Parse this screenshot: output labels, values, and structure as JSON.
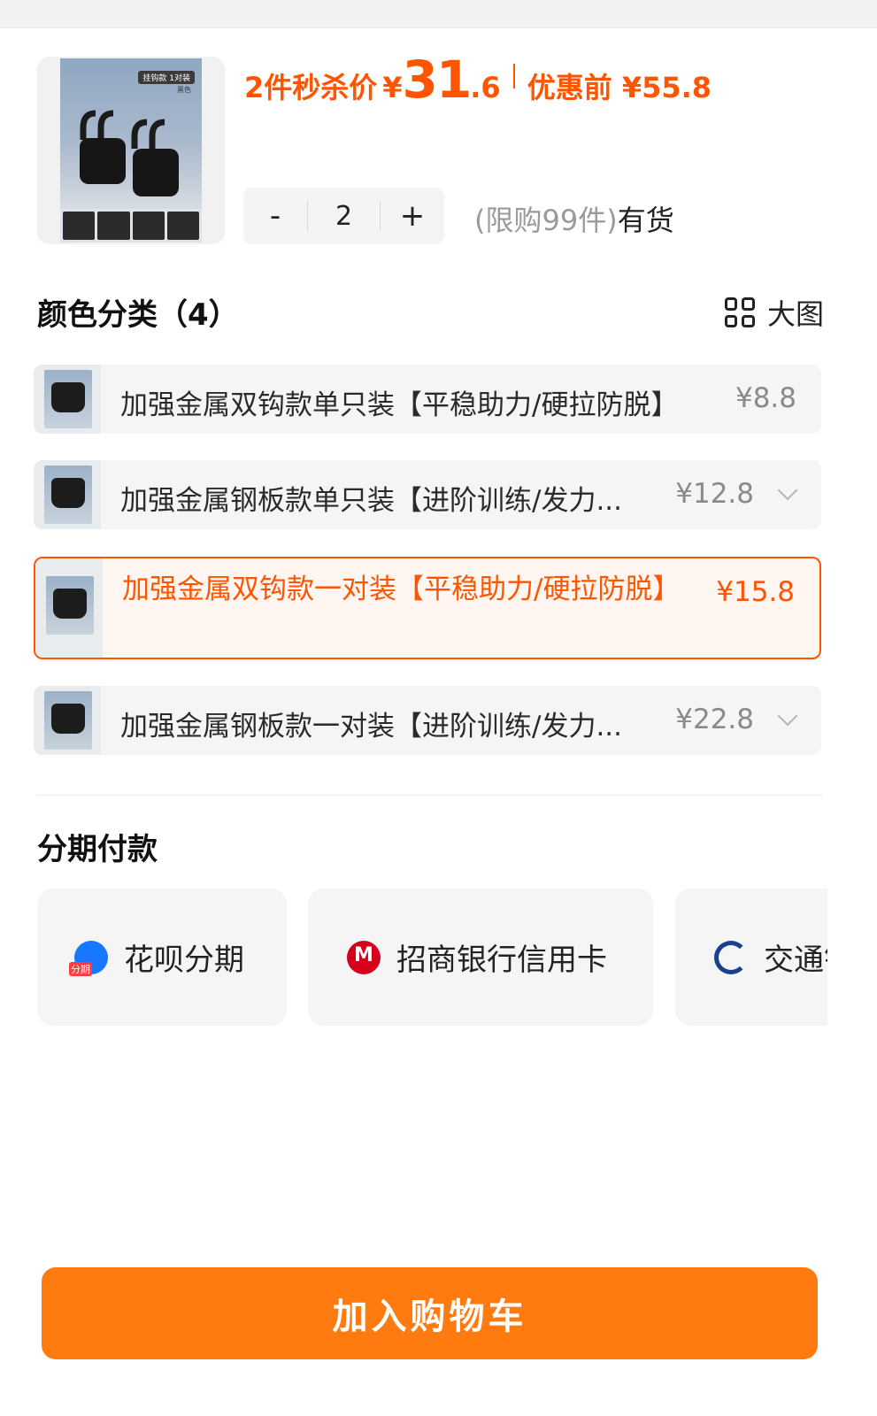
{
  "product": {
    "thumb_tag": "挂钩款 1对装",
    "thumb_sub": "黑色",
    "price_prefix": "2件秒杀价",
    "price_yen": "¥",
    "price_int": "31",
    "price_dec": ".6",
    "price_before": "优惠前 ¥55.8",
    "quantity": "2",
    "minus_label": "-",
    "plus_label": "+",
    "stock_limit": "(限购99件)",
    "stock_status": "有货"
  },
  "color_section": {
    "title": "颜色分类（4）",
    "big_view_label": "大图",
    "options": [
      {
        "label": "加强金属双钩款单只装【平稳助力/硬拉防脱】",
        "price": "¥8.8",
        "selected": false
      },
      {
        "label": "加强金属钢板款单只装【进阶训练/发力...",
        "price": "¥12.8",
        "selected": false
      },
      {
        "label": "加强金属双钩款一对装【平稳助力/硬拉防脱】",
        "price": "¥15.8",
        "selected": true
      },
      {
        "label": "加强金属钢板款一对装【进阶训练/发力...",
        "price": "¥22.8",
        "selected": false
      }
    ]
  },
  "installment": {
    "title": "分期付款",
    "options": [
      {
        "label": "花呗分期",
        "icon": "huabei-icon"
      },
      {
        "label": "招商银行信用卡",
        "icon": "cmb-icon"
      },
      {
        "label": "交通银行信用卡",
        "icon": "bocom-icon"
      }
    ]
  },
  "actions": {
    "add_to_cart": "加入购物车"
  },
  "colors": {
    "accent": "#ff5500",
    "button": "#ff7a0f"
  }
}
